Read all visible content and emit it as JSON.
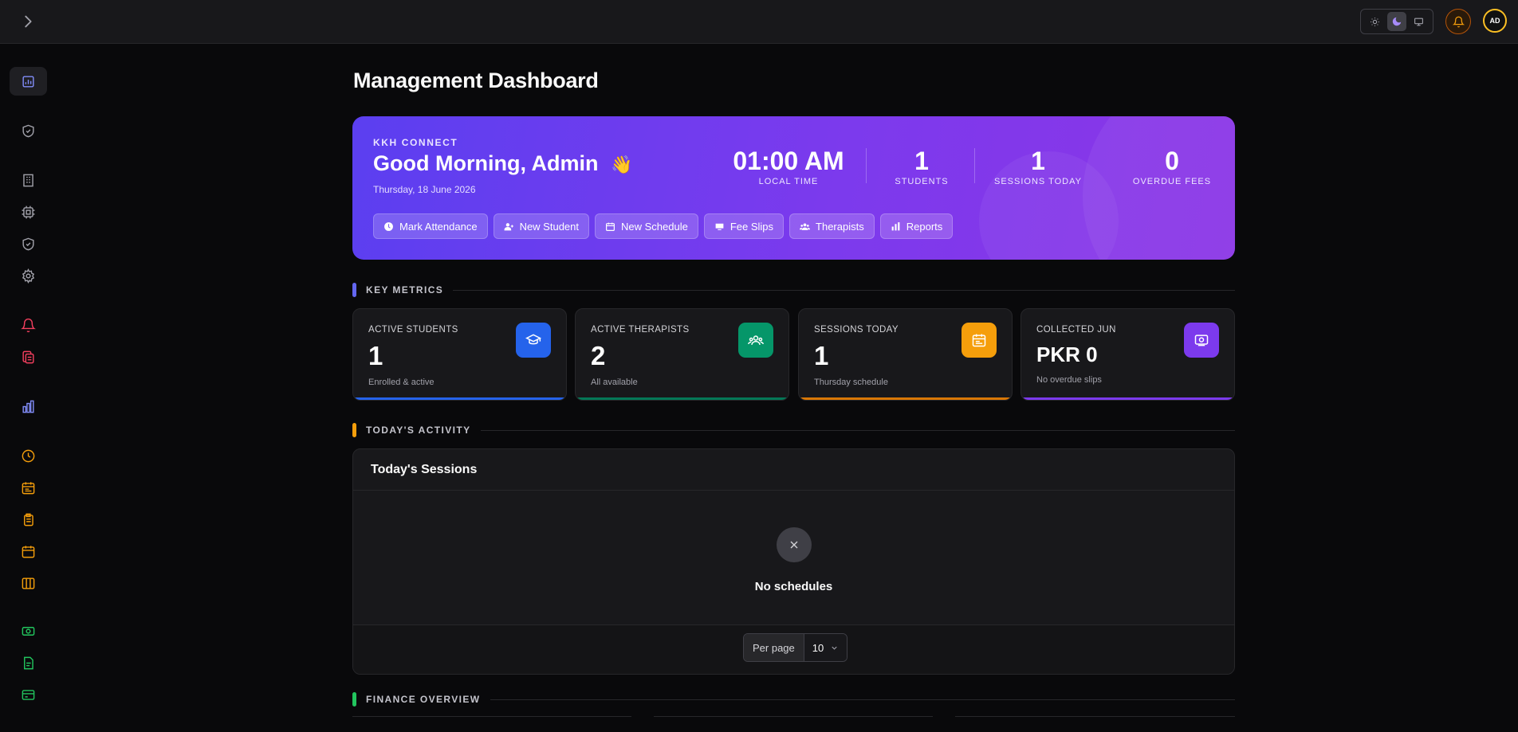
{
  "topbar": {
    "theme_options": [
      "light-icon",
      "dark-icon",
      "system-icon"
    ],
    "active_theme": "dark",
    "avatar_initials": "AD"
  },
  "sidebar": {
    "items": [
      {
        "icon": "bar-chart-icon",
        "color": "#818cf8",
        "active": true
      },
      {
        "icon": "shield-check-icon",
        "color": "#a1a1aa"
      },
      {
        "icon": "building-icon",
        "color": "#a1a1aa"
      },
      {
        "icon": "cpu-icon",
        "color": "#a1a1aa"
      },
      {
        "icon": "shield-check-icon",
        "color": "#a1a1aa"
      },
      {
        "icon": "gear-icon",
        "color": "#a1a1aa"
      },
      {
        "icon": "bell-icon",
        "color": "#f43f5e"
      },
      {
        "icon": "files-icon",
        "color": "#f43f5e"
      },
      {
        "icon": "bar-chart-icon",
        "color": "#818cf8"
      },
      {
        "icon": "clock-icon",
        "color": "#f59e0b"
      },
      {
        "icon": "calendar-list-icon",
        "color": "#f59e0b"
      },
      {
        "icon": "clipboard-icon",
        "color": "#f59e0b"
      },
      {
        "icon": "calendar-icon",
        "color": "#f59e0b"
      },
      {
        "icon": "columns-icon",
        "color": "#f59e0b"
      },
      {
        "icon": "money-icon",
        "color": "#22c55e"
      },
      {
        "icon": "document-icon",
        "color": "#22c55e"
      },
      {
        "icon": "credit-card-icon",
        "color": "#22c55e"
      }
    ]
  },
  "page": {
    "title": "Management Dashboard"
  },
  "hero": {
    "eyebrow": "KKH CONNECT",
    "greeting": "Good Morning, Admin",
    "wave": "👋",
    "date": "Thursday, 18 June 2026",
    "time": "01:00 AM",
    "time_label": "LOCAL TIME",
    "stats": [
      {
        "value": "1",
        "label": "STUDENTS"
      },
      {
        "value": "1",
        "label": "SESSIONS TODAY"
      },
      {
        "value": "0",
        "label": "OVERDUE FEES"
      }
    ],
    "actions": [
      {
        "label": "Mark Attendance",
        "icon": "clock-icon"
      },
      {
        "label": "New Student",
        "icon": "user-plus-icon"
      },
      {
        "label": "New Schedule",
        "icon": "calendar-icon"
      },
      {
        "label": "Fee Slips",
        "icon": "money-icon"
      },
      {
        "label": "Therapists",
        "icon": "users-icon"
      },
      {
        "label": "Reports",
        "icon": "bar-chart-icon"
      }
    ]
  },
  "sections": {
    "key_metrics": "KEY METRICS",
    "todays_activity": "TODAY'S ACTIVITY",
    "finance_overview": "FINANCE OVERVIEW"
  },
  "metrics": [
    {
      "label": "ACTIVE STUDENTS",
      "value": "1",
      "sub": "Enrolled & active",
      "icon": "graduation-cap-icon",
      "color": "#2563eb",
      "bottom": "#2563eb"
    },
    {
      "label": "ACTIVE THERAPISTS",
      "value": "2",
      "sub": "All available",
      "icon": "users-icon",
      "color": "#059669",
      "bottom": "#047857"
    },
    {
      "label": "SESSIONS TODAY",
      "value": "1",
      "sub": "Thursday schedule",
      "icon": "calendar-list-icon",
      "color": "#f59e0b",
      "bottom": "#d97706"
    },
    {
      "label": "COLLECTED JUN",
      "value": "PKR 0",
      "sub": "No overdue slips",
      "icon": "money-icon",
      "color": "#7c3aed",
      "bottom": "#7c3aed"
    }
  ],
  "sessions_panel": {
    "title": "Today's Sessions",
    "empty_text": "No schedules",
    "per_page_label": "Per page",
    "per_page_value": "10"
  }
}
